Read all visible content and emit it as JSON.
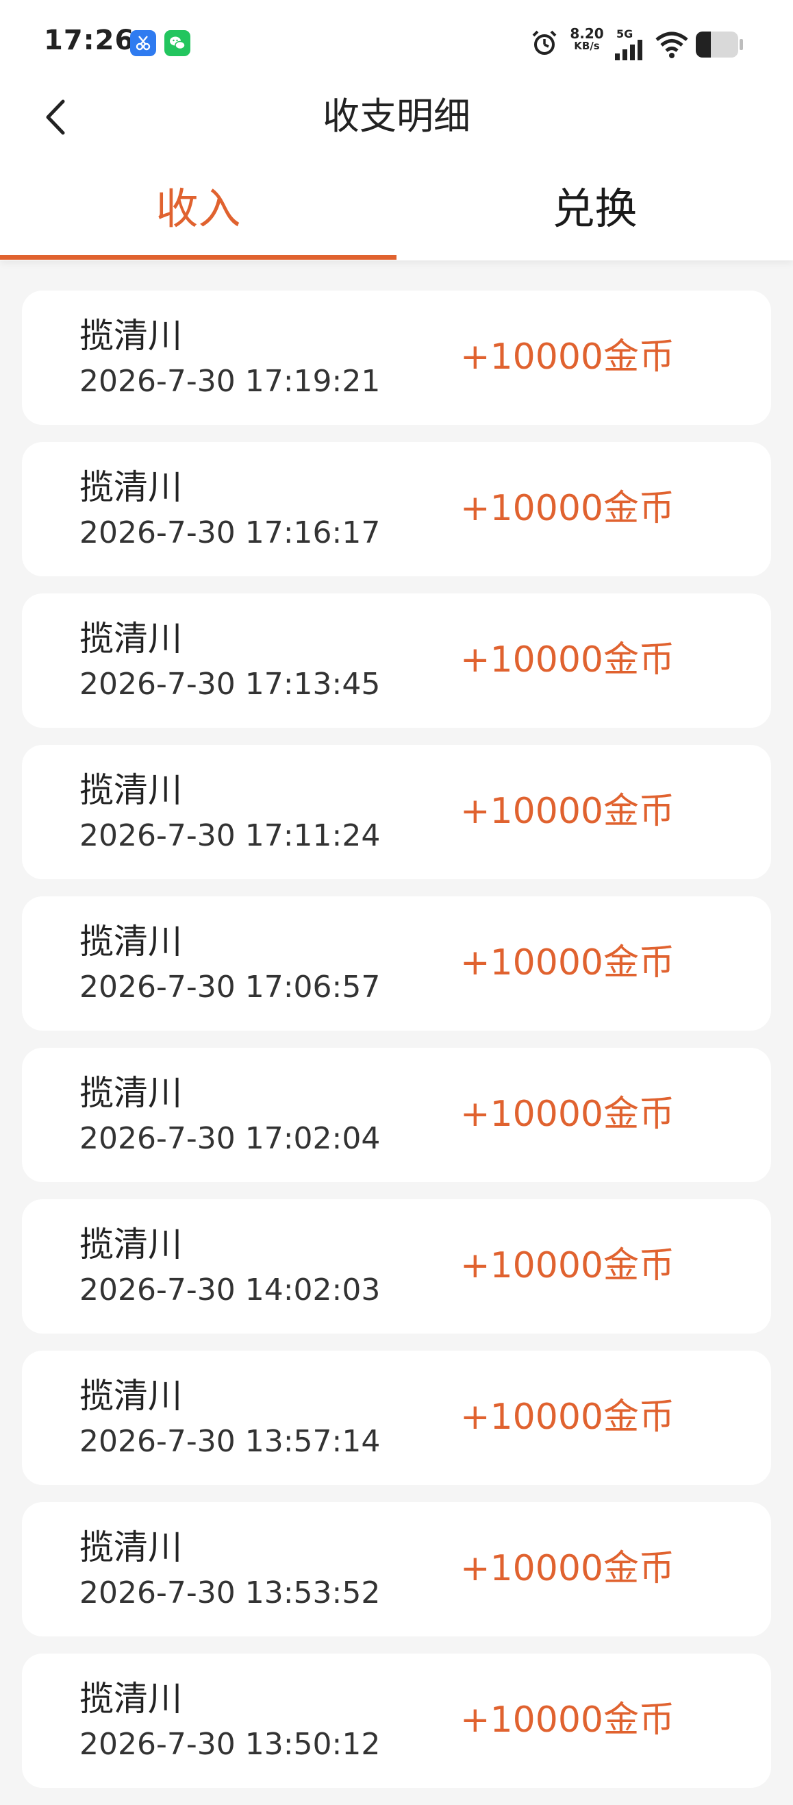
{
  "status_bar": {
    "time": "17:26",
    "net_speed_value": "8.20",
    "net_speed_unit": "KB/s",
    "network_type": "5G",
    "icons": [
      "scissors-app-icon",
      "wechat-icon",
      "alarm-icon",
      "signal-icon",
      "wifi-icon",
      "battery-icon"
    ]
  },
  "header": {
    "title": "收支明细"
  },
  "tabs": [
    {
      "label": "收入",
      "active": true
    },
    {
      "label": "兑换",
      "active": false
    }
  ],
  "colors": {
    "accent": "#e0622f",
    "background": "#f5f5f5",
    "card": "#ffffff"
  },
  "records": [
    {
      "name": "揽清川",
      "time": "2026-7-30 17:19:21",
      "amount": "+10000金币"
    },
    {
      "name": "揽清川",
      "time": "2026-7-30 17:16:17",
      "amount": "+10000金币"
    },
    {
      "name": "揽清川",
      "time": "2026-7-30 17:13:45",
      "amount": "+10000金币"
    },
    {
      "name": "揽清川",
      "time": "2026-7-30 17:11:24",
      "amount": "+10000金币"
    },
    {
      "name": "揽清川",
      "time": "2026-7-30 17:06:57",
      "amount": "+10000金币"
    },
    {
      "name": "揽清川",
      "time": "2026-7-30 17:02:04",
      "amount": "+10000金币"
    },
    {
      "name": "揽清川",
      "time": "2026-7-30 14:02:03",
      "amount": "+10000金币"
    },
    {
      "name": "揽清川",
      "time": "2026-7-30 13:57:14",
      "amount": "+10000金币"
    },
    {
      "name": "揽清川",
      "time": "2026-7-30 13:53:52",
      "amount": "+10000金币"
    },
    {
      "name": "揽清川",
      "time": "2026-7-30 13:50:12",
      "amount": "+10000金币"
    }
  ]
}
